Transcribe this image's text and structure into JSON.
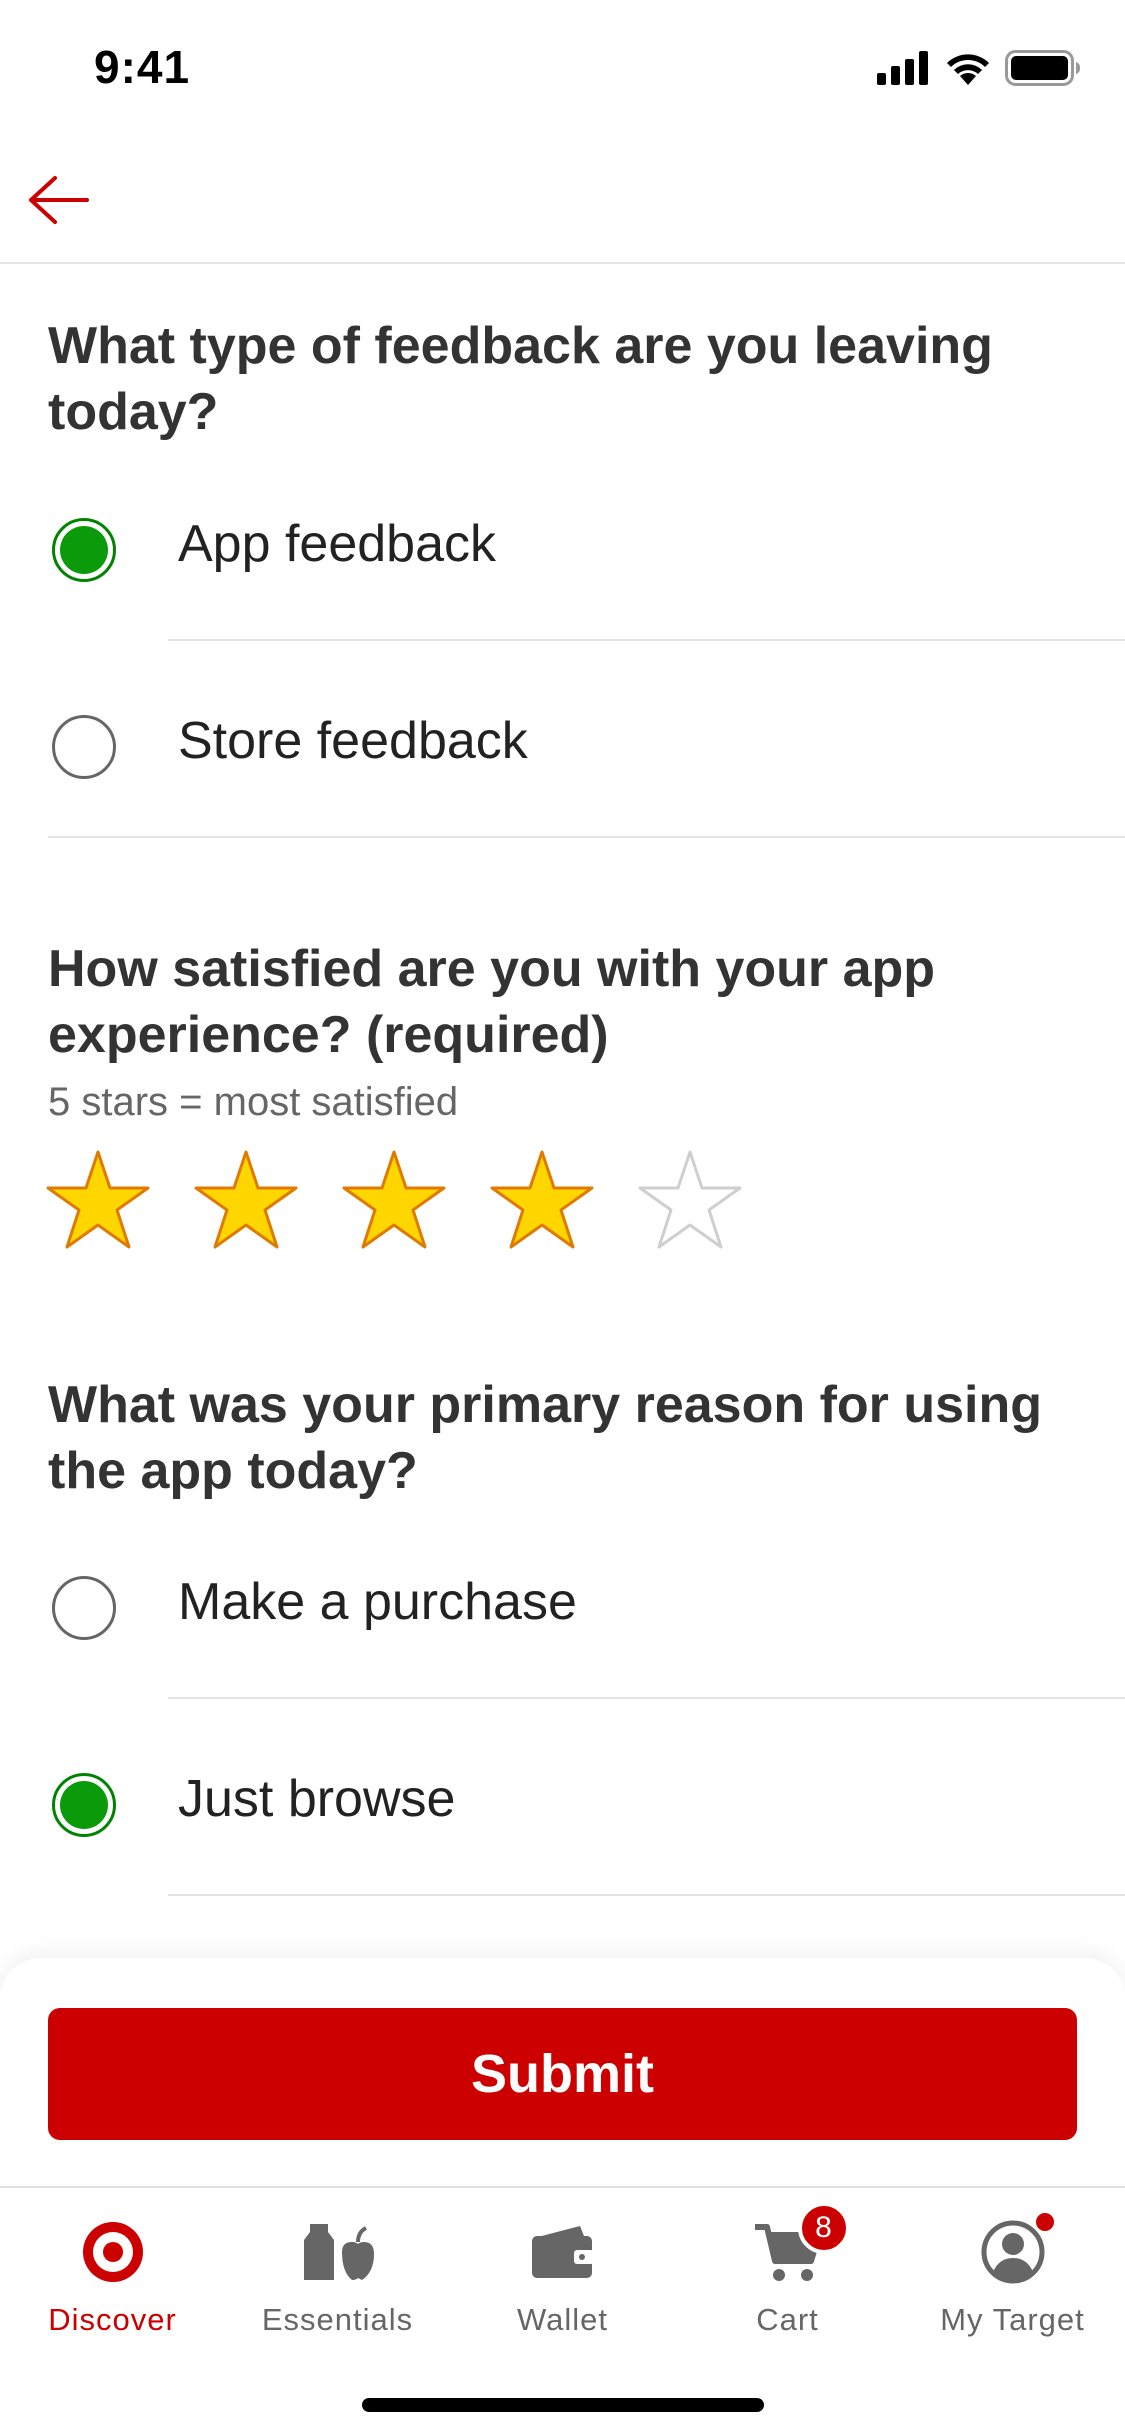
{
  "status_bar": {
    "time": "9:41"
  },
  "questions": {
    "feedback_type": {
      "heading": "What type of feedback are you leaving today?",
      "options": [
        {
          "label": "App feedback",
          "selected": true
        },
        {
          "label": "Store feedback",
          "selected": false
        }
      ]
    },
    "satisfaction": {
      "heading": "How satisfied are you with your app experience? (required)",
      "subtitle": "5 stars = most satisfied",
      "rating": 4,
      "max_rating": 5
    },
    "reason": {
      "heading": "What was your primary reason for using the app today?",
      "options": [
        {
          "label": "Make a purchase",
          "selected": false
        },
        {
          "label": "Just browse",
          "selected": true
        }
      ]
    }
  },
  "submit_label": "Submit",
  "tabs": [
    {
      "label": "Discover",
      "icon": "target-logo-icon",
      "active": true
    },
    {
      "label": "Essentials",
      "icon": "essentials-icon",
      "active": false
    },
    {
      "label": "Wallet",
      "icon": "wallet-icon",
      "active": false
    },
    {
      "label": "Cart",
      "icon": "cart-icon",
      "active": false,
      "badge": "8"
    },
    {
      "label": "My Target",
      "icon": "account-icon",
      "active": false
    }
  ],
  "colors": {
    "brand_red": "#cc0000",
    "selected_green": "#0a9a0a",
    "star_fill": "#ffd600",
    "star_stroke": "#e07a00"
  }
}
